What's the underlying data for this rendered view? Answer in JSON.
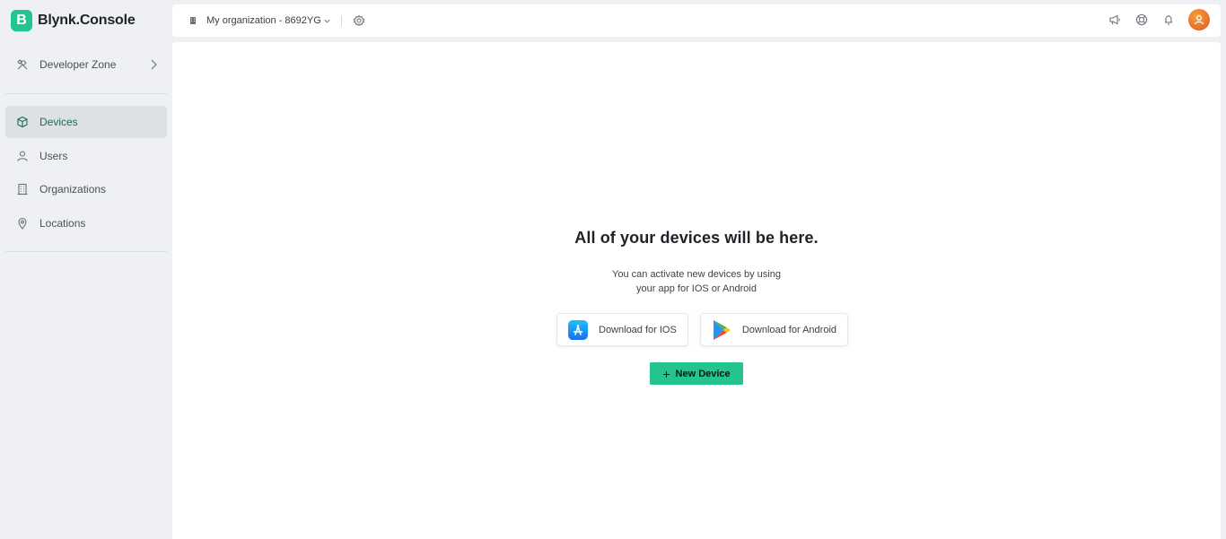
{
  "brand": {
    "logo_letter": "B",
    "name": "Blynk.Console"
  },
  "sidebar": {
    "developer_zone": {
      "label": "Developer Zone",
      "icon": "tools-icon"
    },
    "items": [
      {
        "label": "Devices",
        "icon": "cube-icon",
        "active": true
      },
      {
        "label": "Users",
        "icon": "user-icon",
        "active": false
      },
      {
        "label": "Organizations",
        "icon": "building-icon",
        "active": false
      },
      {
        "label": "Locations",
        "icon": "map-pin-icon",
        "active": false
      }
    ]
  },
  "topbar": {
    "org_name": "My organization - 8692YG",
    "icons": [
      "announcement-icon",
      "help-icon",
      "notification-icon",
      "avatar"
    ]
  },
  "main": {
    "empty_title": "All of your devices will be here.",
    "empty_line1": "You can activate new devices by using",
    "empty_line2": "your app for IOS or Android",
    "download_ios": "Download for IOS",
    "download_android": "Download for Android",
    "new_device": "New Device"
  },
  "colors": {
    "accent": "#23c48e",
    "active_nav_text": "#1b6e4f",
    "background": "#eef0f3"
  }
}
